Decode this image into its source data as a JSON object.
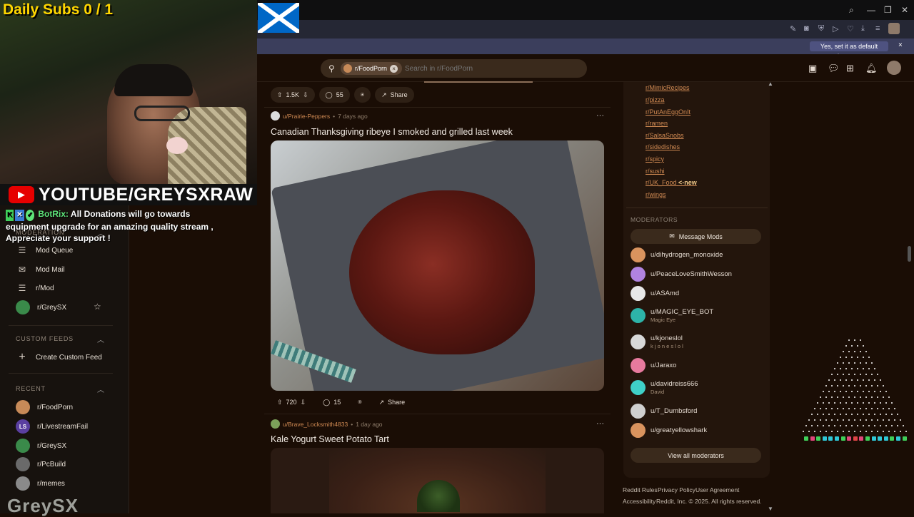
{
  "stream": {
    "daily_subs_label": "Daily Subs",
    "daily_subs_count": "0 / 1",
    "youtube_banner": "YOUTUBE/GREYSXRAW",
    "bot_name": "BotRix:",
    "bot_message": "All Donations will go towards equipment upgrade for an amazing quality stream , Appreciate your support !",
    "watermark": "GreySX"
  },
  "browser": {
    "default_prompt": "Yes, set it as default browser",
    "default_close": "×"
  },
  "header": {
    "search_chip": "r/FoodPorn",
    "search_placeholder": "Search in r/FoodPorn"
  },
  "left_nav": {
    "moderation_heading": "MODERATION",
    "moderation_items": [
      {
        "label": "Mod Queue",
        "icon": "queue-icon"
      },
      {
        "label": "Mod Mail",
        "icon": "mail-icon"
      },
      {
        "label": "r/Mod",
        "icon": "mod-icon"
      },
      {
        "label": "r/GreySX",
        "icon": "community-icon"
      }
    ],
    "custom_feeds_heading": "CUSTOM FEEDS",
    "create_custom_feed": "Create Custom Feed",
    "recent_heading": "RECENT",
    "recent_items": [
      {
        "label": "r/FoodPorn",
        "color": "#c78a58",
        "badge": ""
      },
      {
        "label": "r/LivestreamFail",
        "color": "#5a3fa0",
        "badge": "LS"
      },
      {
        "label": "r/GreySX",
        "color": "#3a8a4a",
        "badge": ""
      },
      {
        "label": "r/PcBuild",
        "color": "#6a6a6a",
        "badge": ""
      },
      {
        "label": "r/memes",
        "color": "#8a8a8a",
        "badge": ""
      }
    ]
  },
  "posts": [
    {
      "upvotes": "1.5K",
      "comments": "55",
      "share_label": "Share"
    },
    {
      "user": "u/Prairie-Peppers",
      "time": "7 days ago",
      "title": "Canadian Thanksgiving ribeye I smoked and grilled last week",
      "upvotes": "720",
      "comments": "15",
      "share_label": "Share"
    },
    {
      "user": "u/Brave_Locksmith4833",
      "time": "1 day ago",
      "title": "Kale Yogurt Sweet Potato Tart"
    }
  ],
  "sidebar": {
    "related_subs": [
      "r/MimicRecipes",
      "r/pizza",
      "r/PutAnEggOnIt",
      "r/ramen",
      "r/SalsaSnobs",
      "r/sidedishes",
      "r/spicy",
      "r/sushi",
      "r/UK_Food",
      "r/wings"
    ],
    "new_tag": "<-new",
    "moderators_heading": "MODERATORS",
    "message_mods": "Message Mods",
    "moderators": [
      {
        "name": "u/dihydrogen_monoxide",
        "flair": "",
        "color": "#d9935e"
      },
      {
        "name": "u/PeaceLoveSmithWesson",
        "flair": "",
        "color": "#b083e0"
      },
      {
        "name": "u/ASAmd",
        "flair": "",
        "color": "#e8e8e8"
      },
      {
        "name": "u/MAGIC_EYE_BOT",
        "flair": "Magic Eye",
        "color": "#2db3a8"
      },
      {
        "name": "u/kjoneslol",
        "flair": "k j o n e s l o l",
        "color": "#d8d8d8"
      },
      {
        "name": "u/Jaraxo",
        "flair": "",
        "color": "#e77a9e"
      },
      {
        "name": "u/davidreiss666",
        "flair": "David",
        "color": "#3fd0c8"
      },
      {
        "name": "u/T_Dumbsford",
        "flair": "",
        "color": "#cfcfcf"
      },
      {
        "name": "u/greatyellowshark",
        "flair": "",
        "color": "#d9935e"
      }
    ],
    "view_all_mods": "View all moderators"
  },
  "footer": {
    "reddit_rules": "Reddit Rules",
    "privacy_policy": "Privacy Policy",
    "user_agreement": "User Agreement",
    "accessibility": "Accessibility",
    "copyright": "Reddit, Inc. © 2025. All rights reserved."
  },
  "colors": {
    "accent_link": "#d08a53",
    "page_bg": "#1a0d05",
    "sidebar_bg": "#23150c"
  }
}
